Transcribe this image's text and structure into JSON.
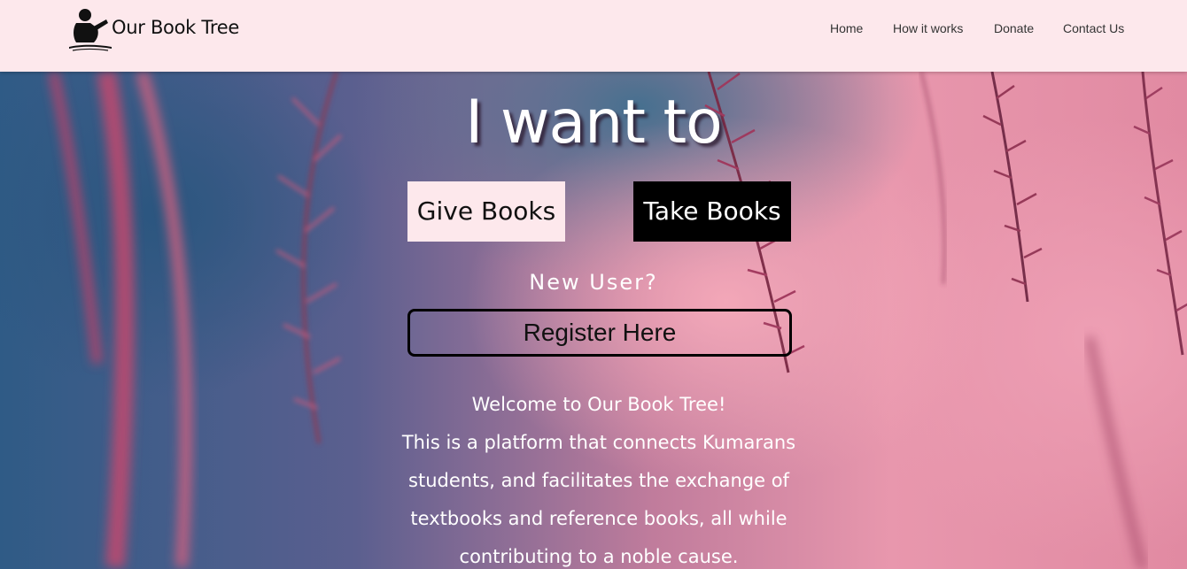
{
  "header": {
    "brand": "Our Book Tree",
    "logo_icon": "child-reading-icon",
    "nav": [
      {
        "label": "Home"
      },
      {
        "label": "How it works"
      },
      {
        "label": "Donate"
      },
      {
        "label": "Contact Us"
      }
    ]
  },
  "hero": {
    "headline": "I want to",
    "give_button": "Give Books",
    "take_button": "Take Books",
    "new_user": "New User?",
    "register_button": "Register Here",
    "welcome_title": "Welcome to Our Book Tree!",
    "welcome_body": "This is a platform that connects Kumarans students, and facilitates the exchange of textbooks and reference books, all while contributing to a noble cause."
  },
  "colors": {
    "header_bg": "#fde8ec",
    "give_button_bg": "#fde8ec",
    "take_button_bg": "#000000",
    "text_light": "#ffffff"
  }
}
